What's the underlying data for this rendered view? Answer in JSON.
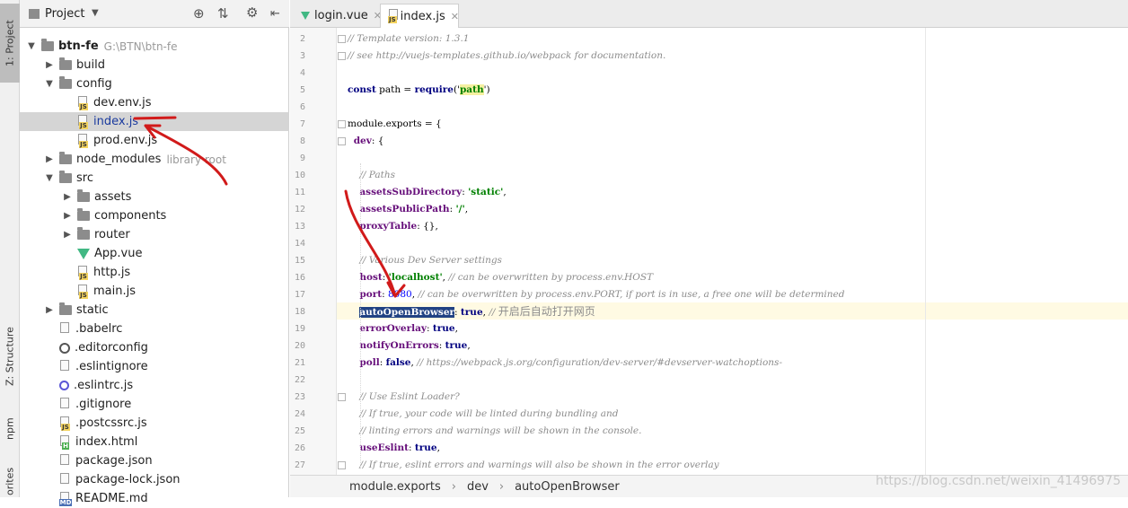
{
  "tool_stripe": {
    "project_tab": "1: Project",
    "structure_tab": "Z: Structure",
    "npm_tab": "npm",
    "favorites_tab": "orites"
  },
  "project_panel": {
    "title": "Project",
    "tree": [
      {
        "label": "btn-fe",
        "hint": "G:\\BTN\\btn-fe",
        "level": 0,
        "type": "folder",
        "expanded": true
      },
      {
        "label": "build",
        "level": 1,
        "type": "folder",
        "expanded": false
      },
      {
        "label": "config",
        "level": 1,
        "type": "folder",
        "expanded": true
      },
      {
        "label": "dev.env.js",
        "level": 2,
        "type": "js"
      },
      {
        "label": "index.js",
        "level": 2,
        "type": "js",
        "selected": true
      },
      {
        "label": "prod.env.js",
        "level": 2,
        "type": "js"
      },
      {
        "label": "node_modules",
        "hint": "library root",
        "level": 1,
        "type": "folder",
        "expanded": false
      },
      {
        "label": "src",
        "level": 1,
        "type": "folder",
        "expanded": true
      },
      {
        "label": "assets",
        "level": 2,
        "type": "folder",
        "expanded": false
      },
      {
        "label": "components",
        "level": 2,
        "type": "folder",
        "expanded": false
      },
      {
        "label": "router",
        "level": 2,
        "type": "folder",
        "expanded": false
      },
      {
        "label": "App.vue",
        "level": 2,
        "type": "vue"
      },
      {
        "label": "http.js",
        "level": 2,
        "type": "js"
      },
      {
        "label": "main.js",
        "level": 2,
        "type": "js"
      },
      {
        "label": "static",
        "level": 1,
        "type": "folder",
        "expanded": false
      },
      {
        "label": ".babelrc",
        "level": 1,
        "type": "file"
      },
      {
        "label": ".editorconfig",
        "level": 1,
        "type": "gear"
      },
      {
        "label": ".eslintignore",
        "level": 1,
        "type": "file"
      },
      {
        "label": ".eslintrc.js",
        "level": 1,
        "type": "ring"
      },
      {
        "label": ".gitignore",
        "level": 1,
        "type": "file"
      },
      {
        "label": ".postcssrc.js",
        "level": 1,
        "type": "js"
      },
      {
        "label": "index.html",
        "level": 1,
        "type": "html"
      },
      {
        "label": "package.json",
        "level": 1,
        "type": "file"
      },
      {
        "label": "package-lock.json",
        "level": 1,
        "type": "file"
      },
      {
        "label": "README.md",
        "level": 1,
        "type": "md"
      }
    ]
  },
  "editor": {
    "tabs": [
      {
        "label": "login.vue",
        "icon": "vue",
        "active": false
      },
      {
        "label": "index.js",
        "icon": "js",
        "active": true
      }
    ],
    "lines": [
      {
        "n": "2",
        "text": "// Template version: 1.3.1"
      },
      {
        "n": "3",
        "text": "// see http://vuejs-templates.github.io/webpack for documentation."
      },
      {
        "n": "4",
        "text": ""
      },
      {
        "n": "5",
        "text": "const path = require('path')"
      },
      {
        "n": "6",
        "text": ""
      },
      {
        "n": "7",
        "text": "module.exports = {"
      },
      {
        "n": "8",
        "text": "  dev: {"
      },
      {
        "n": "9",
        "text": ""
      },
      {
        "n": "10",
        "text": "    // Paths"
      },
      {
        "n": "11",
        "text": "    assetsSubDirectory: 'static',"
      },
      {
        "n": "12",
        "text": "    assetsPublicPath: '/',"
      },
      {
        "n": "13",
        "text": "    proxyTable: {},"
      },
      {
        "n": "14",
        "text": ""
      },
      {
        "n": "15",
        "text": "    // Various Dev Server settings"
      },
      {
        "n": "16",
        "text": "    host: 'localhost', // can be overwritten by process.env.HOST"
      },
      {
        "n": "17",
        "text": "    port: 8080, // can be overwritten by process.env.PORT, if port is in use, a free one will be determined"
      },
      {
        "n": "18",
        "text": "    autoOpenBrowser: true, // 开启后自动打开网页"
      },
      {
        "n": "19",
        "text": "    errorOverlay: true,"
      },
      {
        "n": "20",
        "text": "    notifyOnErrors: true,"
      },
      {
        "n": "21",
        "text": "    poll: false, // https://webpack.js.org/configuration/dev-server/#devserver-watchoptions-"
      },
      {
        "n": "22",
        "text": ""
      },
      {
        "n": "23",
        "text": "    // Use Eslint Loader?"
      },
      {
        "n": "24",
        "text": "    // If true, your code will be linted during bundling and"
      },
      {
        "n": "25",
        "text": "    // linting errors and warnings will be shown in the console."
      },
      {
        "n": "26",
        "text": "    useEslint: true,"
      },
      {
        "n": "27",
        "text": "    // If true, eslint errors and warnings will also be shown in the error overlay"
      }
    ]
  },
  "breadcrumb": [
    "module.exports",
    "dev",
    "autoOpenBrowser"
  ],
  "watermark": "https://blog.csdn.net/weixin_41496975",
  "colors": {
    "annotation": "#d11a1a",
    "selection": "#214283",
    "current_line": "#fffae3"
  }
}
